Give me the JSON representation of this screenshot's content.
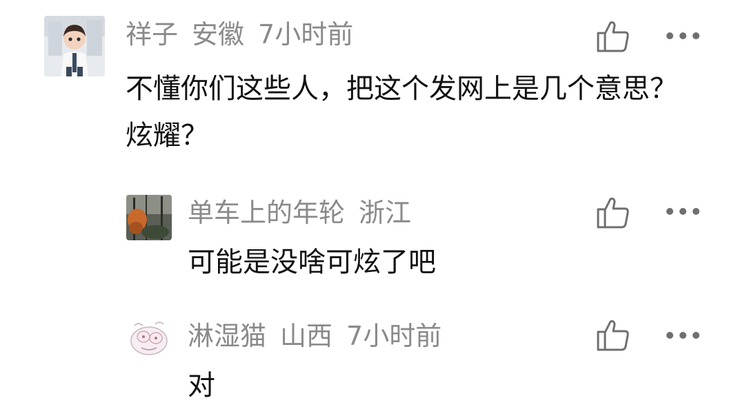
{
  "comments": [
    {
      "username": "祥子",
      "location": "安徽",
      "time": "7小时前",
      "text": "不懂你们这些人，把这个发网上是几个意思？炫耀？",
      "avatar_icon": "cartoon-doctor-avatar",
      "like_icon": "thumbs-up-icon",
      "more_icon": "more-dots-icon"
    },
    {
      "username": "单车上的年轮",
      "location": "浙江",
      "text": "可能是没啥可炫了吧",
      "avatar_icon": "forest-photo-avatar",
      "like_icon": "thumbs-up-icon",
      "more_icon": "more-dots-icon"
    },
    {
      "username": "淋湿猫",
      "location": "山西",
      "time": "7小时前",
      "text": "对",
      "avatar_icon": "cartoon-sticker-avatar",
      "like_icon": "thumbs-up-icon",
      "more_icon": "more-dots-icon"
    }
  ],
  "colors": {
    "meta_text": "#8a8a8a",
    "body_text": "#111111",
    "icon": "#6f6f6f"
  }
}
